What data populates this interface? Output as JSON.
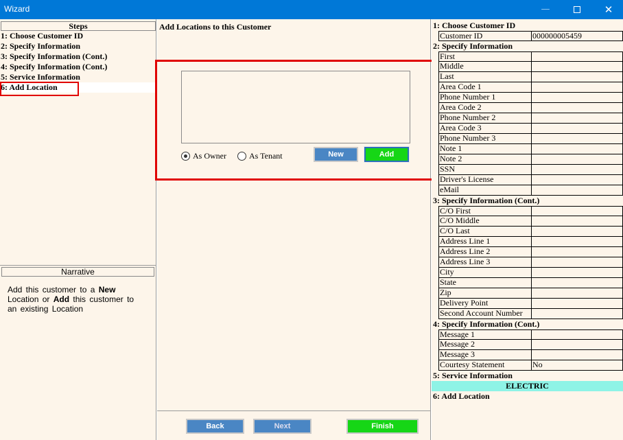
{
  "window": {
    "title": "Wizard",
    "min_glyph": "—",
    "close_glyph": "✕"
  },
  "steps": {
    "header": "Steps",
    "items": [
      {
        "label": "1: Choose Customer ID"
      },
      {
        "label": "2: Specify Information"
      },
      {
        "label": "3: Specify Information (Cont.)"
      },
      {
        "label": "4: Specify Information (Cont.)"
      },
      {
        "label": "5: Service Information"
      },
      {
        "label": "6: Add Location"
      }
    ],
    "selected_index": 5
  },
  "narrative": {
    "title": "Narrative",
    "part1": "Add  this  customer to  a ",
    "bold1": "New",
    "part2": "Location or ",
    "bold2": "Add",
    "part3": "  this  customer to",
    "part4": "an existing Location"
  },
  "main": {
    "title": "Add Locations to this Customer",
    "radio_owner": "As Owner",
    "radio_tenant": "As Tenant",
    "selected_radio": "owner",
    "new_button": "New",
    "add_button": "Add"
  },
  "footer": {
    "back_button": "Back",
    "next_button": "Next",
    "finish_button": "Finish"
  },
  "summary": {
    "section1": {
      "title": "1: Choose Customer ID",
      "rows": [
        {
          "label": "Customer  ID",
          "value": "000000005459"
        }
      ]
    },
    "section2": {
      "title": "2: Specify Information",
      "rows": [
        {
          "label": "First",
          "value": ""
        },
        {
          "label": "Middle",
          "value": ""
        },
        {
          "label": "Last",
          "value": ""
        },
        {
          "label": "Area Code 1",
          "value": ""
        },
        {
          "label": "Phone Number 1",
          "value": ""
        },
        {
          "label": "Area Code 2",
          "value": ""
        },
        {
          "label": "Phone Number 2",
          "value": ""
        },
        {
          "label": "Area Code 3",
          "value": ""
        },
        {
          "label": "Phone Number 3",
          "value": ""
        },
        {
          "label": "Note 1",
          "value": ""
        },
        {
          "label": "Note 2",
          "value": ""
        },
        {
          "label": "SSN",
          "value": ""
        },
        {
          "label": "Driver's License",
          "value": ""
        },
        {
          "label": "eMail",
          "value": ""
        }
      ]
    },
    "section3": {
      "title": "3: Specify Information (Cont.)",
      "rows": [
        {
          "label": "C/O First",
          "value": ""
        },
        {
          "label": "C/O Middle",
          "value": ""
        },
        {
          "label": "C/O Last",
          "value": ""
        },
        {
          "label": "Address Line 1",
          "value": ""
        },
        {
          "label": "Address Line 2",
          "value": ""
        },
        {
          "label": "Address Line 3",
          "value": ""
        },
        {
          "label": "City",
          "value": ""
        },
        {
          "label": "State",
          "value": ""
        },
        {
          "label": "Zip",
          "value": ""
        },
        {
          "label": "Delivery Point",
          "value": ""
        },
        {
          "label": "Second Account Number",
          "value": ""
        }
      ]
    },
    "section4": {
      "title": "4: Specify Information (Cont.)",
      "rows": [
        {
          "label": "Message 1",
          "value": ""
        },
        {
          "label": "Message 2",
          "value": ""
        },
        {
          "label": "Message 3",
          "value": ""
        },
        {
          "label": "Courtesy Statement",
          "value": "No"
        }
      ]
    },
    "section5": {
      "title": "5: Service Information",
      "service": "ELECTRIC"
    },
    "section6": {
      "title": "6: Add Location"
    }
  },
  "colors": {
    "titlebar": "#0078d7",
    "panel_bg": "#fdf5ea",
    "highlight_red": "#e00000",
    "button_blue": "#4a86c4",
    "button_green": "#16d616",
    "service_bar": "#8ef3e6"
  }
}
